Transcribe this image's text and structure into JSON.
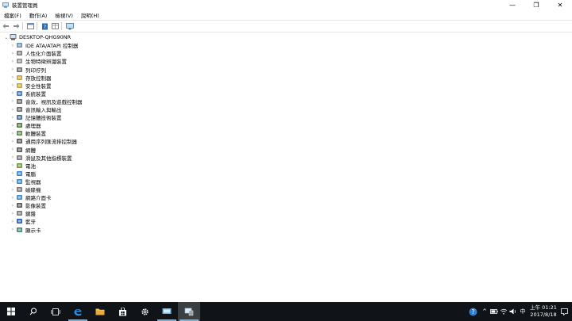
{
  "window": {
    "title": "裝置管理員",
    "minimize": "—",
    "restore": "❐",
    "close": "✕"
  },
  "menu": [
    "檔案(F)",
    "動作(A)",
    "檢視(V)",
    "說明(H)"
  ],
  "tree": {
    "root": "DESKTOP-QHG90NR",
    "items": [
      {
        "label": "IDE ATA/ATAPI 控制器",
        "icon": "ide-controller-icon",
        "color": "#6d8fb3"
      },
      {
        "label": "人性化介面裝置",
        "icon": "hid-icon",
        "color": "#7a7a7a"
      },
      {
        "label": "生物特徵辨識裝置",
        "icon": "biometric-icon",
        "color": "#8a8a8a"
      },
      {
        "label": "列印佇列",
        "icon": "printer-icon",
        "color": "#6a6a6a"
      },
      {
        "label": "存放控制器",
        "icon": "storage-controller-icon",
        "color": "#c9a33a"
      },
      {
        "label": "安全性裝置",
        "icon": "security-device-icon",
        "color": "#c9a33a"
      },
      {
        "label": "系統裝置",
        "icon": "system-device-icon",
        "color": "#3b7bbf"
      },
      {
        "label": "音效，視訊及遊戲控制器",
        "icon": "audio-icon",
        "color": "#6a6a6a"
      },
      {
        "label": "音訊輸入與輸出",
        "icon": "audio-io-icon",
        "color": "#6a6a6a"
      },
      {
        "label": "記憶體技術裝置",
        "icon": "memory-tech-icon",
        "color": "#3f6d96"
      },
      {
        "label": "處理器",
        "icon": "processor-icon",
        "color": "#4a7a3a"
      },
      {
        "label": "軟體裝置",
        "icon": "software-device-icon",
        "color": "#5a8a4a"
      },
      {
        "label": "通用序列匯流排控制器",
        "icon": "usb-icon",
        "color": "#555555"
      },
      {
        "label": "網體",
        "icon": "firmware-icon",
        "color": "#555555"
      },
      {
        "label": "滑鼠及其他指標裝置",
        "icon": "mouse-icon",
        "color": "#777777"
      },
      {
        "label": "電池",
        "icon": "battery-icon",
        "color": "#6a9a3a"
      },
      {
        "label": "電腦",
        "icon": "computer-icon",
        "color": "#3a8ad0"
      },
      {
        "label": "監視器",
        "icon": "monitor-icon",
        "color": "#3a8ad0"
      },
      {
        "label": "磁碟機",
        "icon": "disk-drive-icon",
        "color": "#777777"
      },
      {
        "label": "網路介面卡",
        "icon": "network-adapter-icon",
        "color": "#3a8ad0"
      },
      {
        "label": "影像裝置",
        "icon": "imaging-icon",
        "color": "#555555"
      },
      {
        "label": "鍵盤",
        "icon": "keyboard-icon",
        "color": "#777777"
      },
      {
        "label": "藍牙",
        "icon": "bluetooth-icon",
        "color": "#1f5fbf"
      },
      {
        "label": "顯示卡",
        "icon": "display-adapter-icon",
        "color": "#3a8a6a"
      }
    ]
  },
  "taskbar": {
    "clock_time": "上午 01:21",
    "clock_date": "2017/8/18",
    "ime": "中",
    "tray_up": "^"
  }
}
